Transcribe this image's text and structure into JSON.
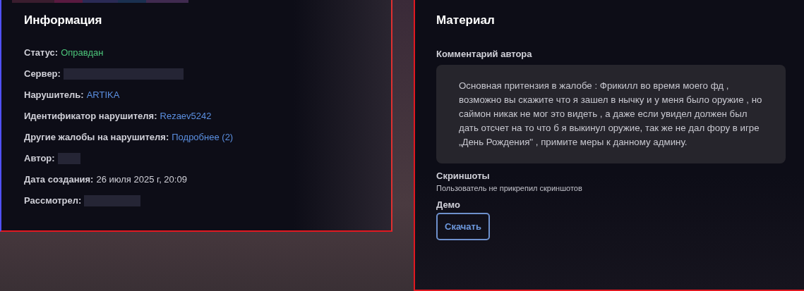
{
  "info": {
    "title": "Информация",
    "rows": [
      {
        "label": "Статус:",
        "kind": "status",
        "value": "Оправдан"
      },
      {
        "label": "Сервер:",
        "kind": "redacted"
      },
      {
        "label": "Нарушитель:",
        "kind": "link",
        "value": "ARTIKA"
      },
      {
        "label": "Идентификатор нарушителя:",
        "kind": "link",
        "value": "Rezaev5242"
      },
      {
        "label": "Другие жалобы на нарушителя:",
        "kind": "link",
        "value": "Подробнее (2)"
      },
      {
        "label": "Автор:",
        "kind": "redacted"
      },
      {
        "label": "Дата создания:",
        "kind": "text",
        "value": "26 июля 2025 г, 20:09"
      },
      {
        "label": "Рассмотрел:",
        "kind": "redacted"
      }
    ]
  },
  "material": {
    "title": "Материал",
    "comment_heading": "Комментарий автора",
    "comment": "Основная притензия в жалобе : Фрикилл во время моего фд , возможно вы скажите что я зашел в нычку и у меня было оружие , но саймон никак не мог это видеть , а даже если увидел должен был дать отсчет на то что б я выкинул оружие, так же не дал фору в игре „День Рождения\" , примите меры к данному админу.",
    "screenshots_heading": "Скриншоты",
    "screenshots_note": "Пользователь не прикрепил скриншотов",
    "demo_heading": "Демо",
    "download_button": "Скачать"
  }
}
